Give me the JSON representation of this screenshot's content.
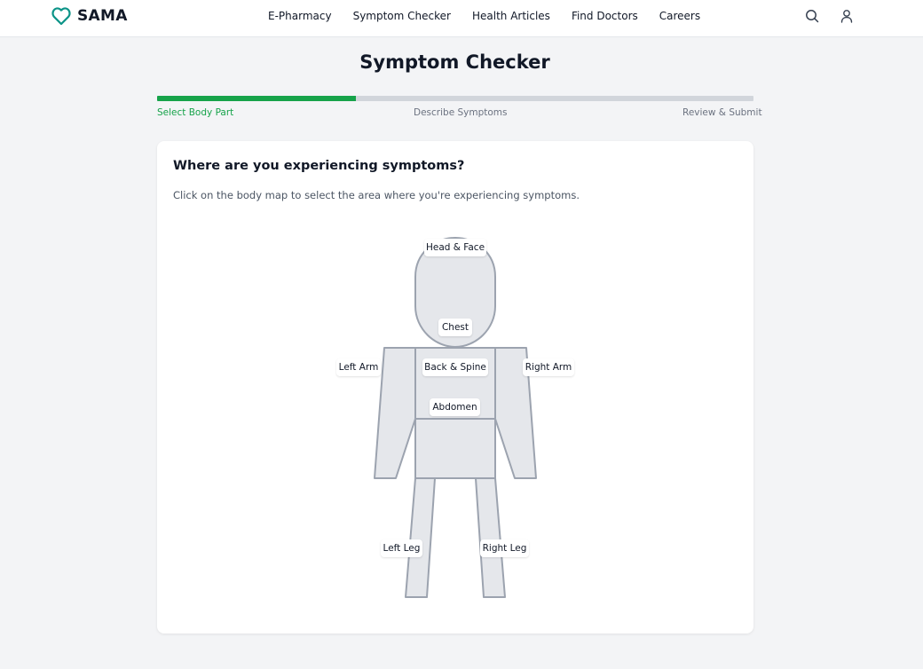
{
  "brand": {
    "name": "SAMA",
    "icon": "heart-icon",
    "color": "#0d9488"
  },
  "nav": {
    "items": [
      "E-Pharmacy",
      "Symptom Checker",
      "Health Articles",
      "Find Doctors",
      "Careers"
    ]
  },
  "header_icons": {
    "search": "search-icon",
    "user": "user-icon"
  },
  "page": {
    "title": "Symptom Checker"
  },
  "progress": {
    "value": 0.333,
    "color": "#16a34a",
    "steps": [
      "Select Body Part",
      "Describe Symptoms",
      "Review & Submit"
    ],
    "active_step": 0
  },
  "card": {
    "title": "Where are you experiencing symptoms?",
    "description": "Click on the body map to select the area where you're experiencing symptoms."
  },
  "body_map": {
    "regions": {
      "head": "Head & Face",
      "chest": "Chest",
      "back": "Back & Spine",
      "abdomen": "Abdomen",
      "left_arm": "Left Arm",
      "right_arm": "Right Arm",
      "left_leg": "Left Leg",
      "right_leg": "Right Leg"
    },
    "fill": "#e5e7eb",
    "stroke": "#9ca3af"
  }
}
